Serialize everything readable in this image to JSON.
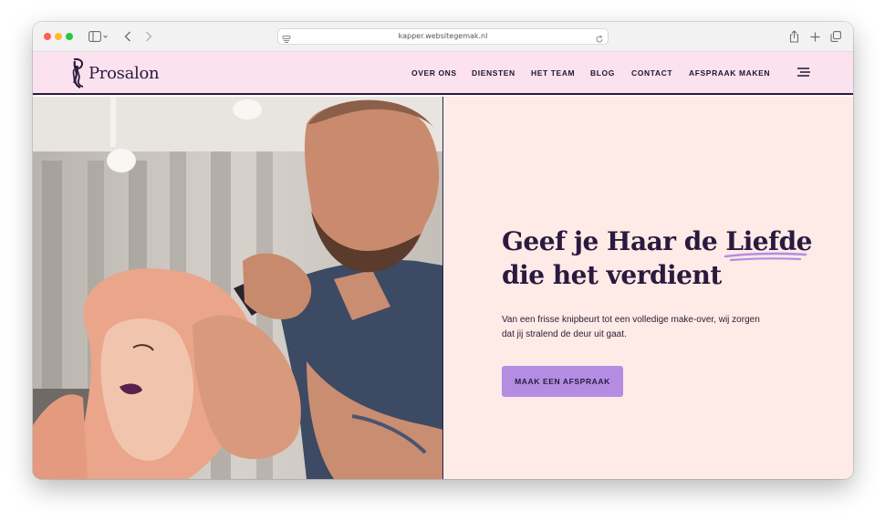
{
  "browser": {
    "url": "kapper.websitegemak.nl",
    "traffic_lights": [
      "#ff5f57",
      "#febc2e",
      "#28c840"
    ]
  },
  "site": {
    "logo_text": "Prosalon",
    "nav": {
      "items": [
        "OVER ONS",
        "DIENSTEN",
        "HET TEAM",
        "BLOG",
        "CONTACT",
        "AFSPRAAK MAKEN"
      ]
    },
    "hero": {
      "headline_part1": "Geef je Haar de ",
      "headline_highlight": "Liefde",
      "headline_part2": "die het verdient",
      "subtext": "Van een frisse knipbeurt tot een volledige make-over, wij zorgen dat jij stralend de deur uit gaat.",
      "cta_label": "MAAK EEN AFSPRAAK"
    }
  },
  "colors": {
    "nav_bg": "#fce2ef",
    "hero_bg": "#feeae6",
    "dark_purple": "#2a1a3f",
    "accent": "#b48de3"
  }
}
